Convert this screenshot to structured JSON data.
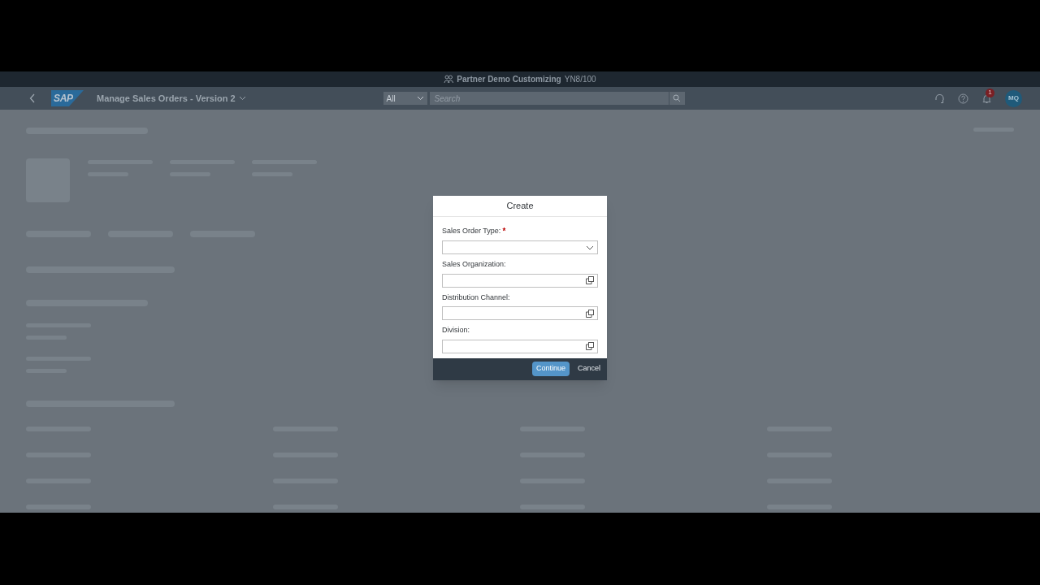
{
  "system_bar": {
    "title": "Partner Demo Customizing",
    "system": "YN8/100"
  },
  "shell": {
    "logo": "SAP",
    "app_title": "Manage Sales Orders - Version 2",
    "search_scope": "All",
    "search_placeholder": "Search",
    "notification_count": "1",
    "avatar": "MQ"
  },
  "dialog": {
    "title": "Create",
    "fields": [
      {
        "label": "Sales Order Type:",
        "marker": "*",
        "kind": "select"
      },
      {
        "label": "Sales Organization:",
        "kind": "value-help"
      },
      {
        "label": "Distribution Channel:",
        "kind": "value-help"
      },
      {
        "label": "Division:",
        "kind": "value-help"
      }
    ],
    "buttons": [
      {
        "label": "Continue",
        "kind": "primary"
      },
      {
        "label": "Cancel",
        "kind": "plain"
      }
    ]
  }
}
